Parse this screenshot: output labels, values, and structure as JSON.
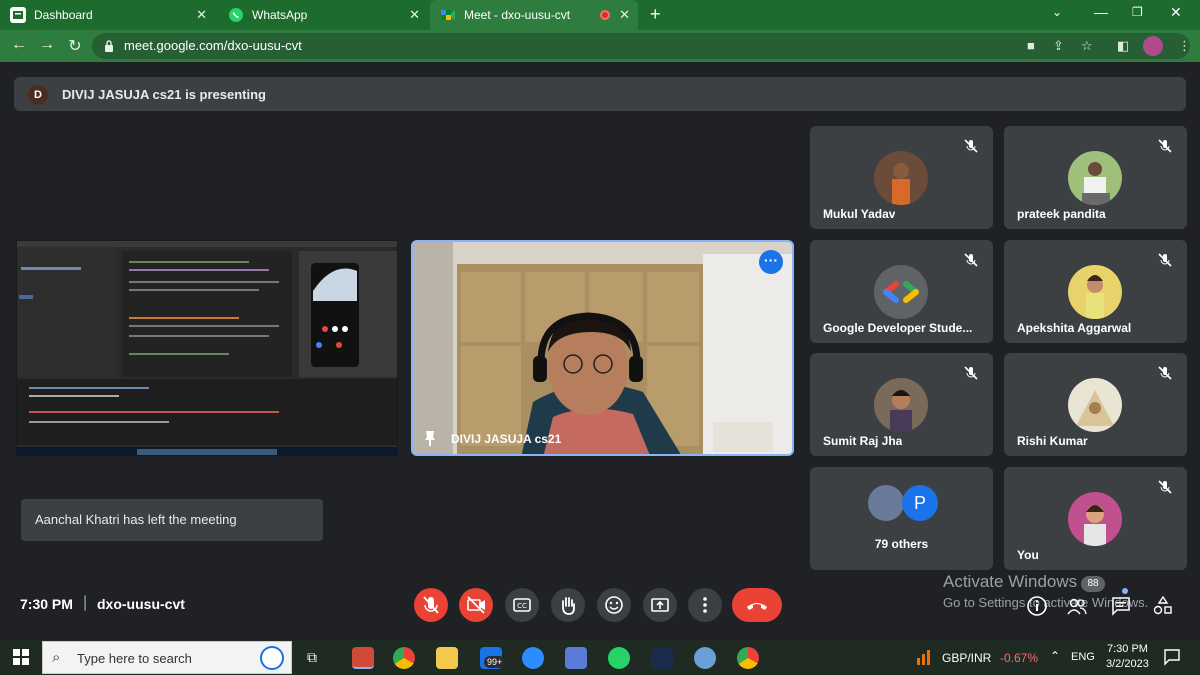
{
  "browser": {
    "tabs": [
      {
        "title": "Dashboard",
        "icon": "dashboard-icon",
        "active": false
      },
      {
        "title": "WhatsApp",
        "icon": "whatsapp-icon",
        "active": false
      },
      {
        "title": "Meet - dxo-uusu-cvt",
        "icon": "meet-icon",
        "active": true
      }
    ],
    "url": "meet.google.com/dxo-uusu-cvt",
    "new_tab_label": "+",
    "colors": {
      "frame": "#1e6b2e",
      "toolbar": "#2f7d3e"
    }
  },
  "meet": {
    "presenting_avatar": "D",
    "presenting_text": "DIVIJ JASUJA cs21 is presenting",
    "main_video_name": "DIVIJ JASUJA cs21",
    "participants": [
      {
        "name": "Mukul Yadav",
        "muted": true
      },
      {
        "name": "prateek pandita",
        "muted": true
      },
      {
        "name": "Google Developer Stude...",
        "muted": true
      },
      {
        "name": "Apekshita Aggarwal",
        "muted": true
      },
      {
        "name": "Sumit Raj Jha",
        "muted": true
      },
      {
        "name": "Rishi Kumar",
        "muted": true
      },
      {
        "name": "79 others",
        "muted": false,
        "avatar_letter": "P"
      },
      {
        "name": "You",
        "muted": true
      }
    ],
    "toast": "Aanchal Khatri has left the meeting",
    "time": "7:30 PM",
    "separator": "|",
    "meeting_code": "dxo-uusu-cvt",
    "chat_badge": "88",
    "watermark_title": "Activate Windows",
    "watermark_sub": "Go to Settings to activate Windows.",
    "colors": {
      "background": "#202124",
      "tile": "#3c4043",
      "red": "#ea4335",
      "highlight": "#8ab4f8"
    }
  },
  "taskbar": {
    "search_placeholder": "Type here to search",
    "mail_badge": "99+",
    "stock_label": "GBP/INR",
    "stock_change": "-0.67%",
    "lang": "ENG",
    "time": "7:30 PM",
    "date": "3/2/2023"
  }
}
